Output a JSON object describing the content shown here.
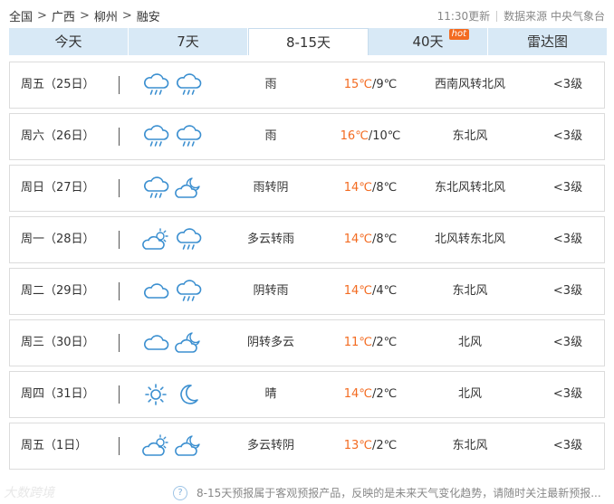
{
  "breadcrumb": {
    "items": [
      "全国",
      "广西",
      "柳州",
      "融安"
    ],
    "separator": ">"
  },
  "meta": {
    "updated": "11:30更新",
    "source": "数据来源 中央气象台"
  },
  "tabs": [
    {
      "label": "今天"
    },
    {
      "label": "7天"
    },
    {
      "label": "8-15天",
      "active": true
    },
    {
      "label": "40天",
      "badge": "hot"
    },
    {
      "label": "雷达图"
    }
  ],
  "days": [
    {
      "day": "周五（25日）",
      "icons": [
        "rain-cloud-icon",
        "rain-cloud-icon"
      ],
      "desc": "雨",
      "high": "15℃",
      "low": "/9℃",
      "wind": "西南风转北风",
      "level": "<3级"
    },
    {
      "day": "周六（26日）",
      "icons": [
        "rain-cloud-icon",
        "rain-cloud-icon"
      ],
      "desc": "雨",
      "high": "16℃",
      "low": "/10℃",
      "wind": "东北风",
      "level": "<3级"
    },
    {
      "day": "周日（27日）",
      "icons": [
        "rain-cloud-icon",
        "cloudy-night-icon"
      ],
      "desc": "雨转阴",
      "high": "14℃",
      "low": "/8℃",
      "wind": "东北风转北风",
      "level": "<3级"
    },
    {
      "day": "周一（28日）",
      "icons": [
        "partly-cloudy-icon",
        "rain-cloud-icon"
      ],
      "desc": "多云转雨",
      "high": "14℃",
      "low": "/8℃",
      "wind": "北风转东北风",
      "level": "<3级"
    },
    {
      "day": "周二（29日）",
      "icons": [
        "cloud-icon",
        "rain-cloud-icon"
      ],
      "desc": "阴转雨",
      "high": "14℃",
      "low": "/4℃",
      "wind": "东北风",
      "level": "<3级"
    },
    {
      "day": "周三（30日）",
      "icons": [
        "cloud-icon",
        "cloudy-night-icon"
      ],
      "desc": "阴转多云",
      "high": "11℃",
      "low": "/2℃",
      "wind": "北风",
      "level": "<3级"
    },
    {
      "day": "周四（31日）",
      "icons": [
        "sun-icon",
        "moon-icon"
      ],
      "desc": "晴",
      "high": "14℃",
      "low": "/2℃",
      "wind": "北风",
      "level": "<3级"
    },
    {
      "day": "周五（1日）",
      "icons": [
        "partly-cloudy-icon",
        "cloudy-night-icon"
      ],
      "desc": "多云转阴",
      "high": "13℃",
      "low": "/2℃",
      "wind": "东北风",
      "level": "<3级"
    }
  ],
  "footer": {
    "watermark": "大数跨境",
    "note": "8-15天预报属于客观预报产品，反映的是未来天气变化趋势，请随时关注最新预报..."
  },
  "colors": {
    "accent": "#f36b21",
    "tab_bg": "#d8e9f6",
    "icon": "#3b8fd0"
  }
}
